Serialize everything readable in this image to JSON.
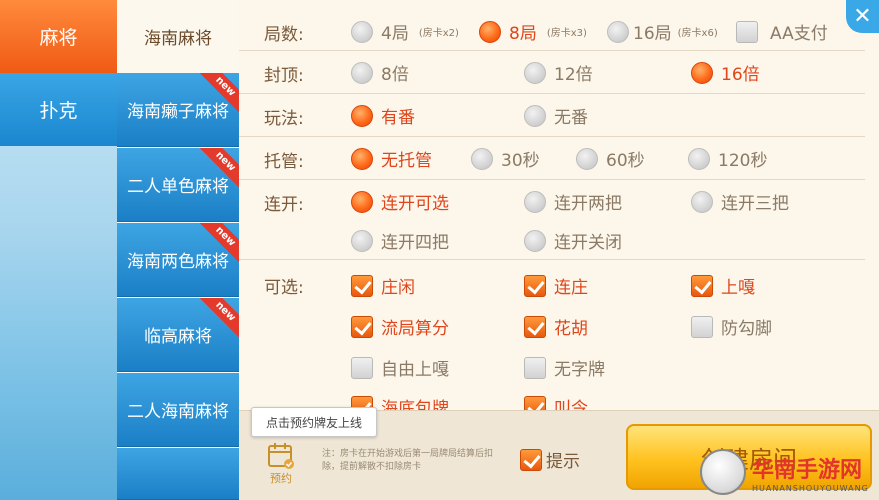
{
  "main_categories": [
    {
      "label": "麻将",
      "active": true
    },
    {
      "label": "扑克",
      "active": false
    }
  ],
  "sub_categories": [
    {
      "label": "海南麻将",
      "active": true,
      "badge": ""
    },
    {
      "label": "海南癞子麻将",
      "active": false,
      "badge": "new"
    },
    {
      "label": "二人单色麻将",
      "active": false,
      "badge": "new"
    },
    {
      "label": "海南两色麻将",
      "active": false,
      "badge": "new"
    },
    {
      "label": "临高麻将",
      "active": false,
      "badge": "new"
    },
    {
      "label": "二人海南麻将",
      "active": false,
      "badge": ""
    }
  ],
  "rows": {
    "rounds": {
      "label": "局数:",
      "options": [
        {
          "label": "4局",
          "note": "(房卡x2)",
          "selected": false
        },
        {
          "label": "8局",
          "note": "(房卡x3)",
          "selected": true
        },
        {
          "label": "16局",
          "note": "(房卡x6)",
          "selected": false
        },
        {
          "label": "AA支付",
          "note": "",
          "selected": false
        }
      ]
    },
    "cap": {
      "label": "封顶:",
      "options": [
        {
          "label": "8倍",
          "selected": false
        },
        {
          "label": "12倍",
          "selected": false
        },
        {
          "label": "16倍",
          "selected": true
        }
      ]
    },
    "play": {
      "label": "玩法:",
      "options": [
        {
          "label": "有番",
          "selected": true
        },
        {
          "label": "无番",
          "selected": false
        }
      ]
    },
    "hosting": {
      "label": "托管:",
      "options": [
        {
          "label": "无托管",
          "selected": true
        },
        {
          "label": "30秒",
          "selected": false
        },
        {
          "label": "60秒",
          "selected": false
        },
        {
          "label": "120秒",
          "selected": false
        }
      ]
    },
    "consecutive": {
      "label": "连开:",
      "options": [
        {
          "label": "连开可选",
          "selected": true
        },
        {
          "label": "连开两把",
          "selected": false
        },
        {
          "label": "连开三把",
          "selected": false
        },
        {
          "label": "连开四把",
          "selected": false
        },
        {
          "label": "连开关闭",
          "selected": false
        }
      ]
    },
    "optional": {
      "label": "可选:",
      "options": [
        {
          "label": "庄闲",
          "checked": true
        },
        {
          "label": "连庄",
          "checked": true
        },
        {
          "label": "上嘎",
          "checked": true
        },
        {
          "label": "流局算分",
          "checked": true
        },
        {
          "label": "花胡",
          "checked": true
        },
        {
          "label": "防勾脚",
          "checked": false
        },
        {
          "label": "自由上嘎",
          "checked": false
        },
        {
          "label": "无字牌",
          "checked": false
        },
        {
          "label": "海底包牌",
          "checked": true
        },
        {
          "label": "叫令",
          "checked": true
        }
      ]
    }
  },
  "bottom": {
    "tooltip": "点击预约牌友上线",
    "reserve_label": "预约",
    "note": "注：房卡在开始游戏后第一局牌局结算后扣除，提前解散不扣除房卡",
    "tip_label": "提示",
    "tip_checked": true,
    "create_label": "创建房间"
  },
  "close_icon": "close-icon",
  "watermark": {
    "title": "华南手游网",
    "subtitle": "HUANANSHOUYOUWANG"
  },
  "colors": {
    "accent_orange": "#f05a14",
    "tab_blue": "#1b7fc6",
    "selected_text": "#e0451b",
    "panel_bg": "#fdf6ea"
  }
}
